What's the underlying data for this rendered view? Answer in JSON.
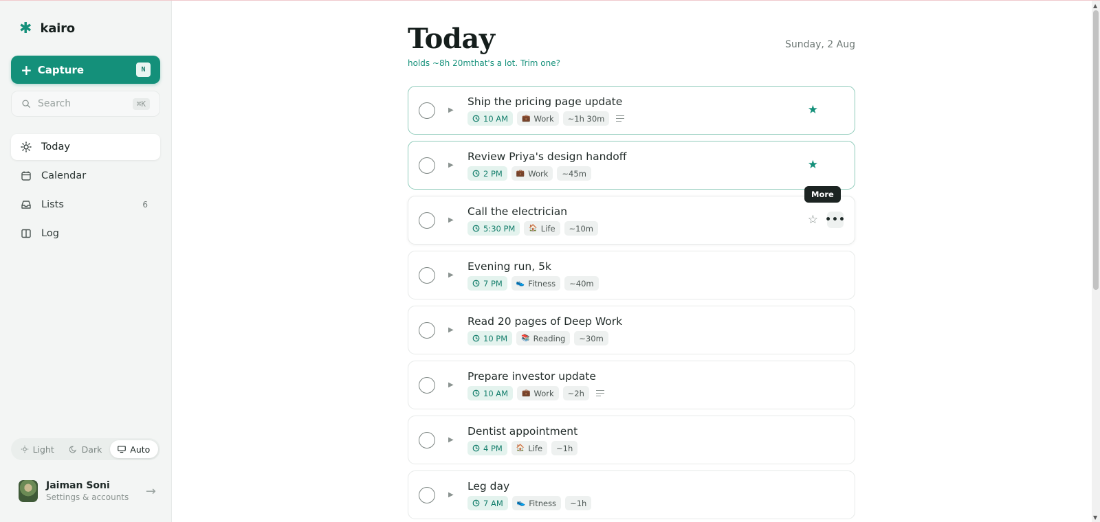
{
  "app": {
    "brand_name": "kairo",
    "brand_mark": "✱"
  },
  "sidebar": {
    "capture": {
      "label": "Capture",
      "shortcut": "N"
    },
    "search": {
      "placeholder": "Search",
      "shortcut": "⌘K"
    },
    "nav": [
      {
        "label": "Today",
        "icon": "sun-icon",
        "active": true
      },
      {
        "label": "Calendar",
        "icon": "calendar-icon"
      },
      {
        "label": "Lists",
        "icon": "inbox-icon",
        "count": "6"
      },
      {
        "label": "Log",
        "icon": "book-icon"
      }
    ],
    "theme": [
      {
        "label": "Light",
        "icon": "sun-icon"
      },
      {
        "label": "Dark",
        "icon": "moon-icon"
      },
      {
        "label": "Auto",
        "icon": "monitor-icon",
        "active": true
      }
    ],
    "user": {
      "name": "Jaiman Soni",
      "subtitle": "Settings & accounts",
      "arrow": "→"
    }
  },
  "main": {
    "title": "Today",
    "date": "Sunday, 2 Aug",
    "subtitle": "holds ~8h 20mthat's a lot. Trim one?",
    "tooltip": "More",
    "tasks": [
      {
        "title": "Ship the pricing page update",
        "time": "10 AM",
        "category": "Work",
        "category_icon": "💼",
        "duration": "~1h 30m",
        "has_notes": true,
        "starred": true
      },
      {
        "title": "Review Priya's design handoff",
        "time": "2 PM",
        "category": "Work",
        "category_icon": "💼",
        "duration": "~45m",
        "has_notes": false,
        "starred": true
      },
      {
        "title": "Call the electrician",
        "time": "5:30 PM",
        "category": "Life",
        "category_icon": "🏠",
        "duration": "~10m",
        "has_notes": false,
        "starred": false,
        "hovered": true
      },
      {
        "title": "Evening run, 5k",
        "time": "7 PM",
        "category": "Fitness",
        "category_icon": "👟",
        "duration": "~40m",
        "has_notes": false,
        "starred": false
      },
      {
        "title": "Read 20 pages of Deep Work",
        "time": "10 PM",
        "category": "Reading",
        "category_icon": "📚",
        "duration": "~30m",
        "has_notes": false,
        "starred": false
      },
      {
        "title": "Prepare investor update",
        "time": "10 AM",
        "category": "Work",
        "category_icon": "💼",
        "duration": "~2h",
        "has_notes": true,
        "starred": false
      },
      {
        "title": "Dentist appointment",
        "time": "4 PM",
        "category": "Life",
        "category_icon": "🏠",
        "duration": "~1h",
        "has_notes": false,
        "starred": false
      },
      {
        "title": "Leg day",
        "time": "7 AM",
        "category": "Fitness",
        "category_icon": "👟",
        "duration": "~1h",
        "has_notes": false,
        "starred": false
      }
    ]
  },
  "colors": {
    "accent": "#14907a",
    "sidebar_bg": "#f3f5f4",
    "chip_bg": "#eef1f0",
    "time_chip_bg": "#e4f3ee"
  }
}
